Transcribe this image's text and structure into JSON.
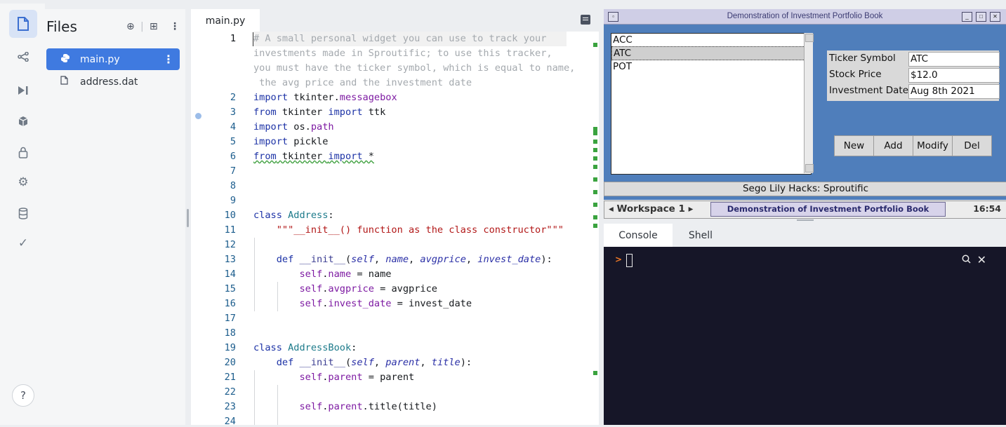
{
  "files": {
    "title": "Files",
    "items": [
      {
        "label": "main.py",
        "icon": "python-icon",
        "active": true
      },
      {
        "label": "address.dat",
        "icon": "file-icon",
        "active": false
      }
    ]
  },
  "help": {
    "label": "?"
  },
  "editor": {
    "tab": "main.py",
    "lines": [
      {
        "n": "1",
        "html": "<span class=\"cm\"># A small personal widget you can use to track your</span>"
      },
      {
        "n": "",
        "html": "<span class=\"cm\">investments made in Sproutific; to use this tracker,</span>"
      },
      {
        "n": "",
        "html": "<span class=\"cm\">you must have the ticker symbol, which is equal to name,</span>"
      },
      {
        "n": "",
        "html": "<span class=\"cm\"> the avg price and the investment date</span>"
      },
      {
        "n": "2",
        "html": "<span class=\"kw\">import</span> tkinter.<span class=\"mod\">messagebox</span>"
      },
      {
        "n": "3",
        "html": "<span class=\"kw\">from</span> tkinter <span class=\"kw\">import</span> ttk"
      },
      {
        "n": "4",
        "html": "<span class=\"kw\">import</span> os.<span class=\"mod\">path</span>"
      },
      {
        "n": "5",
        "html": "<span class=\"kw\">import</span> pickle"
      },
      {
        "n": "6",
        "html": "<span class=\"squig\"><span class=\"kw\">from</span> tkinter <span class=\"kw\">import</span> *</span>"
      },
      {
        "n": "7",
        "html": ""
      },
      {
        "n": "8",
        "html": ""
      },
      {
        "n": "9",
        "html": ""
      },
      {
        "n": "10",
        "html": "<span class=\"kw\">class</span> <span class=\"cls\">Address</span>:"
      },
      {
        "n": "11",
        "html": "    <span class=\"str\">\"\"\"__init__() function as the class constructor\"\"\"</span>"
      },
      {
        "n": "12",
        "html": ""
      },
      {
        "n": "13",
        "html": "    <span class=\"kw\">def</span> <span class=\"sf\">__init__</span>(<span class=\"prm\">self</span>, <span class=\"prm\">name</span>, <span class=\"prm\">avgprice</span>, <span class=\"prm\">invest_date</span>):"
      },
      {
        "n": "14",
        "html": "        <span class=\"mod\">self</span>.<span class=\"mod\">name</span> = name"
      },
      {
        "n": "15",
        "html": "        <span class=\"mod\">self</span>.<span class=\"mod\">avgprice</span> = avgprice"
      },
      {
        "n": "16",
        "html": "        <span class=\"mod\">self</span>.<span class=\"mod\">invest_date</span> = invest_date"
      },
      {
        "n": "17",
        "html": ""
      },
      {
        "n": "18",
        "html": ""
      },
      {
        "n": "19",
        "html": "<span class=\"kw\">class</span> <span class=\"cls\">AddressBook</span>:"
      },
      {
        "n": "20",
        "html": "    <span class=\"kw\">def</span> <span class=\"sf\">__init__</span>(<span class=\"prm\">self</span>, <span class=\"prm\">parent</span>, <span class=\"prm\">title</span>):"
      },
      {
        "n": "21",
        "html": "        <span class=\"mod\">self</span>.<span class=\"mod\">parent</span> = parent"
      },
      {
        "n": "22",
        "html": ""
      },
      {
        "n": "23",
        "html": "        <span class=\"mod\">self</span>.<span class=\"mod\">parent</span>.title(title)"
      },
      {
        "n": "24",
        "html": ""
      }
    ]
  },
  "tk": {
    "title": "Demonstration of Investment Portfolio Book",
    "list": [
      "ACC",
      "ATC",
      "POT"
    ],
    "selected": "ATC",
    "fields": {
      "ticker_label": "Ticker Symbol",
      "ticker_value": "ATC",
      "price_label": "Stock Price",
      "price_value": "$12.0",
      "date_label": "Investment Date",
      "date_value": "Aug 8th 2021"
    },
    "buttons": {
      "new": "New",
      "add": "Add",
      "modify": "Modify",
      "del": "Del"
    },
    "status": "Sego Lily Hacks: Sproutific"
  },
  "taskbar": {
    "workspace": "Workspace 1",
    "task": "Demonstration of Investment Portfolio Book",
    "clock": "16:54"
  },
  "console": {
    "tabs": [
      "Console",
      "Shell"
    ],
    "active_tab": "Console",
    "prompt": ">"
  }
}
